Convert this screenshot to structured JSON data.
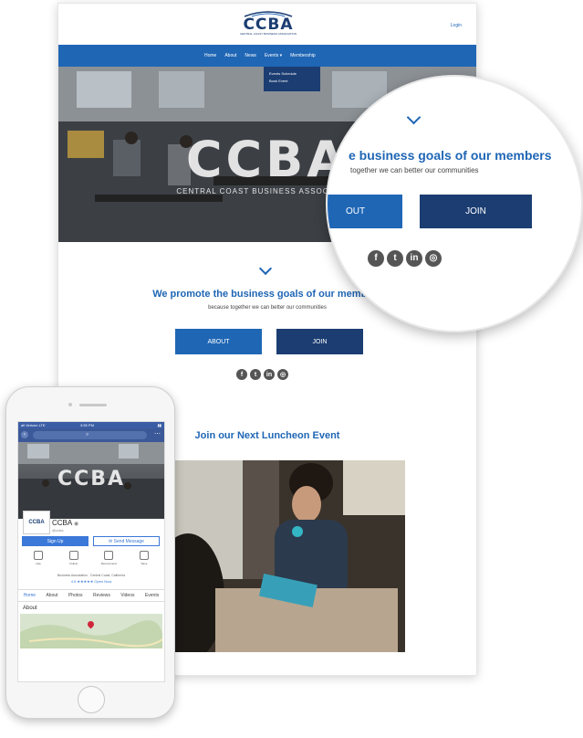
{
  "desktop": {
    "logo": {
      "text": "CCBA",
      "subtitle": "CENTRAL COAST BUSINESS ASSOCIATION"
    },
    "login": "Login",
    "nav": [
      {
        "label": "Home"
      },
      {
        "label": "About"
      },
      {
        "label": "News"
      },
      {
        "label": "Events"
      },
      {
        "label": "Membership"
      }
    ],
    "dropdown": [
      "Events Schedule",
      "Book Event"
    ],
    "hero": {
      "title": "CCBA",
      "subtitle": "CENTRAL COAST BUSINESS ASSOCIATION"
    },
    "tagline": "We promote the business goals of our members",
    "tagline_sub": "because together we can better our communities",
    "buttons": {
      "about": "ABOUT",
      "join": "JOIN"
    },
    "socials": [
      {
        "icon": "facebook-icon",
        "glyph": "f"
      },
      {
        "icon": "twitter-icon",
        "glyph": "t"
      },
      {
        "icon": "linkedin-icon",
        "glyph": "in"
      },
      {
        "icon": "instagram-icon",
        "glyph": "◎"
      }
    ],
    "event_title": "Join our Next Luncheon Event"
  },
  "magnifier": {
    "tagline": "e business goals of our members",
    "tagline_sub": "together we can better our communities",
    "about": "OUT",
    "join": "JOIN"
  },
  "phone": {
    "status": {
      "carrier": "all Verizon LTE",
      "time": "3:55 PM",
      "battery": "▮▮"
    },
    "cover_title": "CCBA",
    "page": {
      "avatar_text": "CCBA",
      "name": "CCBA",
      "handle": "@ccba"
    },
    "buttons": {
      "signup": "Sign Up",
      "send": "Send Message"
    },
    "actions": [
      "Like",
      "Follow",
      "Recommend",
      "Save"
    ],
    "description": "Business Association · Central Coast, California",
    "rating": "4.9 ★★★★★ Open Now",
    "tabs": [
      "Home",
      "About",
      "Photos",
      "Reviews",
      "Videos",
      "Events"
    ],
    "about_heading": "About"
  },
  "colors": {
    "brand_blue": "#1f66b5",
    "navy": "#1b3d72",
    "facebook": "#3b5998"
  }
}
